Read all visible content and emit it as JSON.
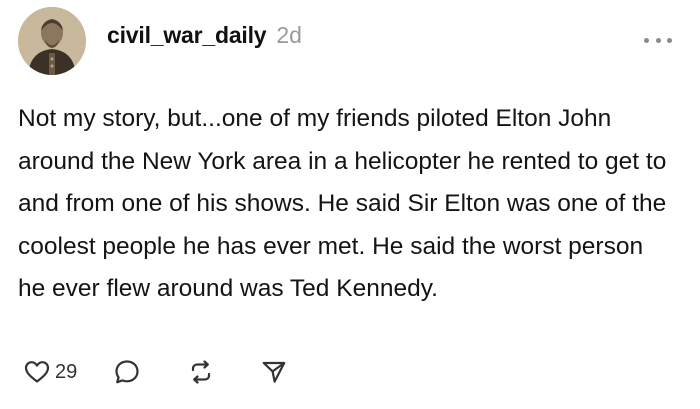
{
  "post": {
    "username": "civil_war_daily",
    "timestamp": "2d",
    "text": "Not my story, but...one of my friends piloted Elton John around the New York area in a helicopter he rented to get to and from one of his shows. He said Sir Elton was one of the coolest people he has ever met. He said the worst person he ever flew around was Ted Kennedy.",
    "avatar": "portrait-photo",
    "more_icon": "more-horizontal-icon"
  },
  "actions": {
    "like": {
      "icon": "heart-icon",
      "count": "29"
    },
    "reply": {
      "icon": "comment-bubble-icon"
    },
    "repost": {
      "icon": "repost-arrows-icon"
    },
    "share": {
      "icon": "send-paper-plane-icon"
    }
  },
  "colors": {
    "background": "#ffffff",
    "text": "#141414",
    "muted": "#9a9a9a",
    "icon": "#333333"
  }
}
